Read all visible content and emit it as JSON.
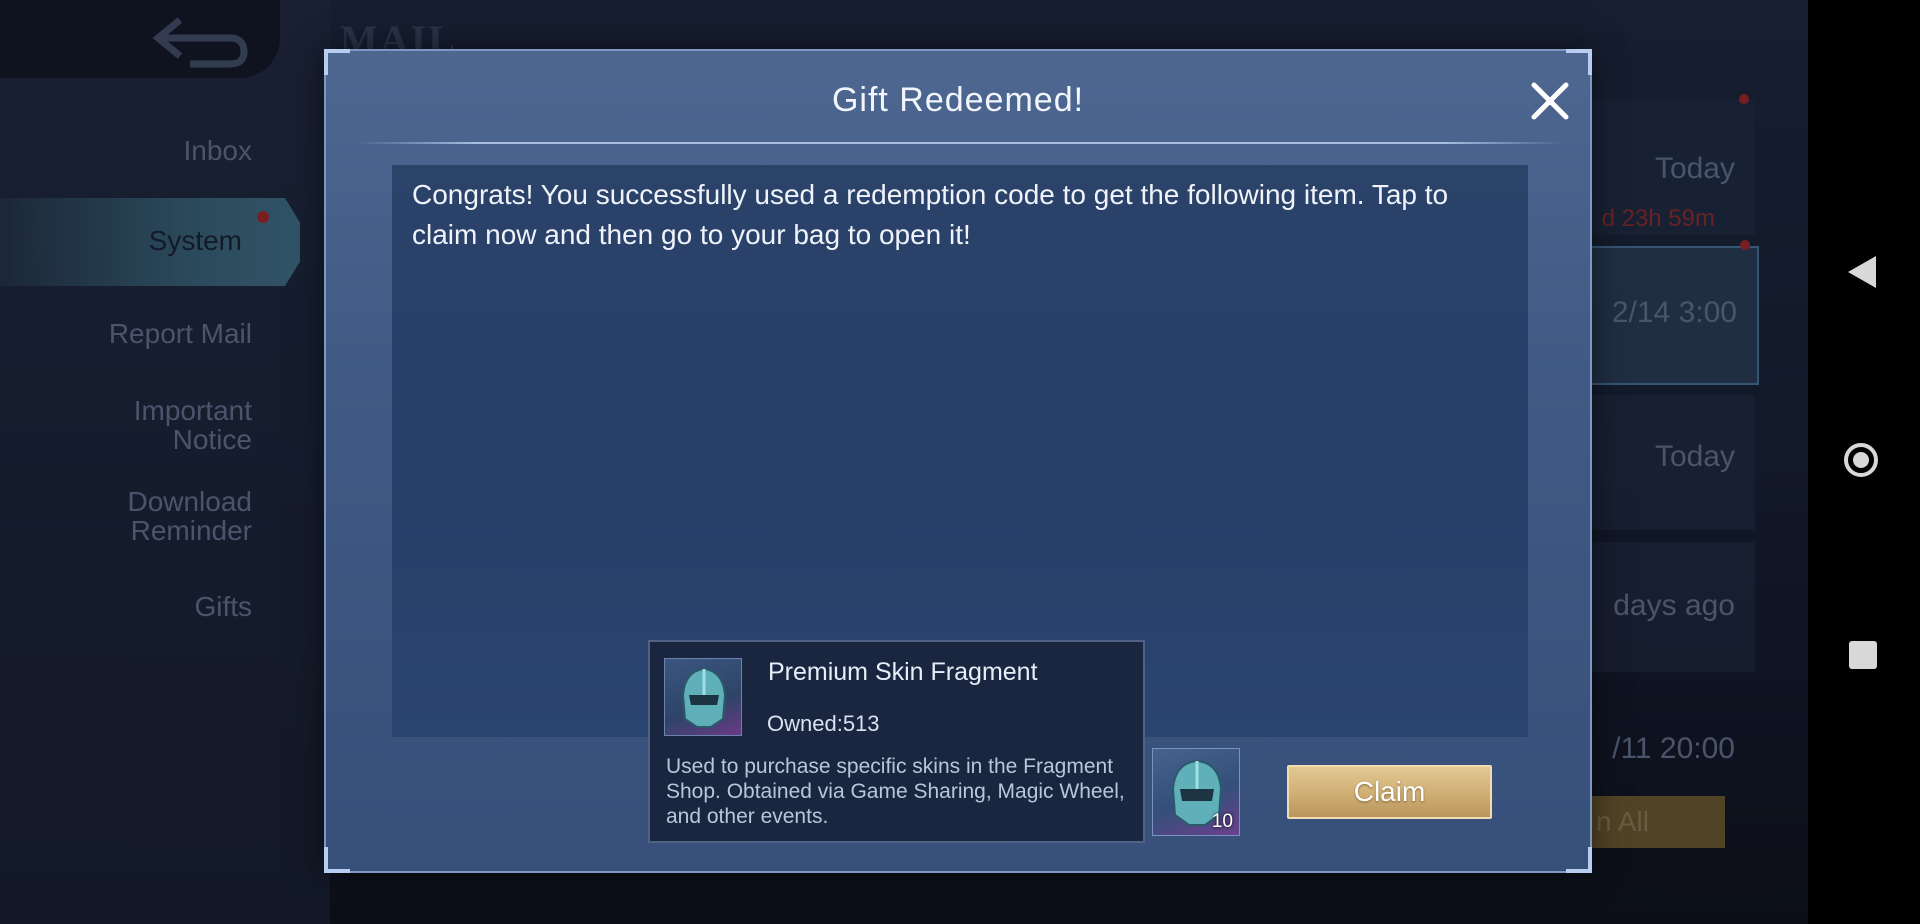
{
  "background": {
    "title": "MAIL",
    "sidebar": [
      {
        "label": "Inbox"
      },
      {
        "label": "System",
        "active": true,
        "has_notification": true
      },
      {
        "label": "Report Mail"
      },
      {
        "label": "Important Notice"
      },
      {
        "label": "Download Reminder"
      },
      {
        "label": "Gifts"
      }
    ],
    "mail_list": [
      {
        "time": "Today",
        "expiry": "d 23h 59m"
      },
      {
        "time": "2/14 3:00"
      },
      {
        "time": "Today"
      },
      {
        "time": "days ago"
      },
      {
        "time": "/11 20:00"
      }
    ],
    "claim_all_label": "n All"
  },
  "dialog": {
    "title": "Gift Redeemed!",
    "message": "Congrats! You successfully used a redemption code to get the following item. Tap to claim now and then go to your bag to open it!",
    "item": {
      "name": "Premium Skin Fragment",
      "owned": "Owned:513",
      "description": "Used to purchase specific skins in the Fragment Shop. Obtained via Game Sharing, Magic Wheel, and other events.",
      "icon": "helmet-fragment-icon"
    },
    "reward": {
      "count": "10",
      "icon": "helmet-fragment-icon"
    },
    "claim_label": "Claim"
  },
  "colors": {
    "accent": "#cfae74",
    "dialog_bg": "#405a85",
    "notification": "#b52a2a"
  }
}
